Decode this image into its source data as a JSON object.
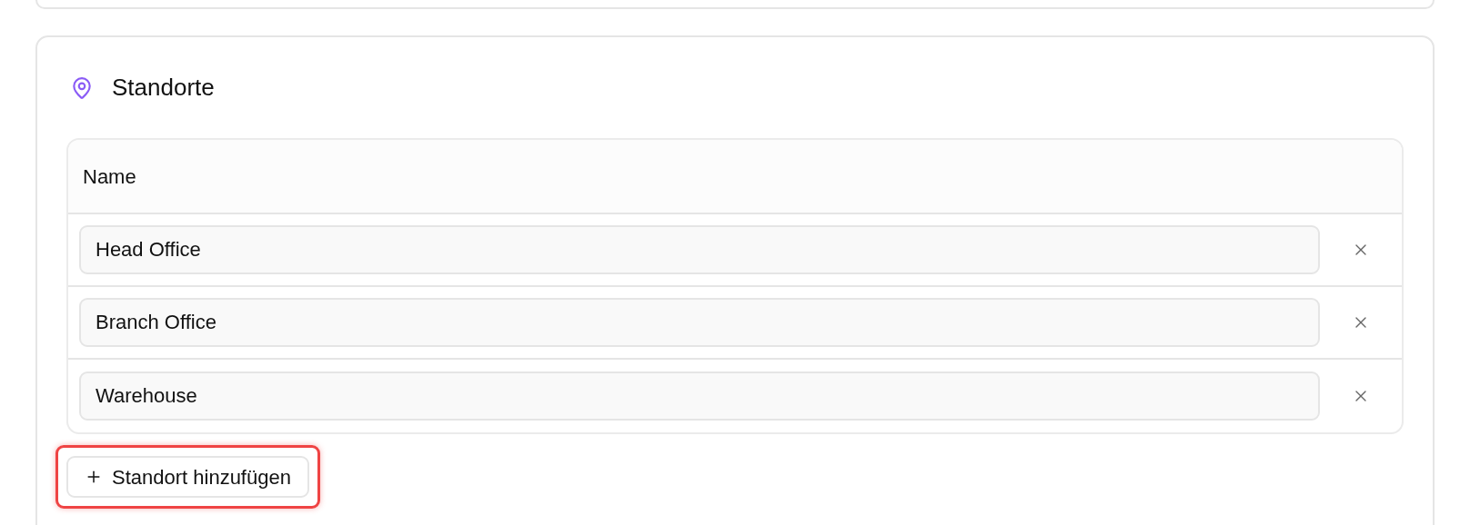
{
  "section": {
    "title": "Standorte"
  },
  "table": {
    "columns": [
      "Name"
    ],
    "rows": [
      {
        "name": "Head Office"
      },
      {
        "name": "Branch Office"
      },
      {
        "name": "Warehouse"
      }
    ]
  },
  "add_button": {
    "label": "Standort hinzufügen",
    "highlighted": true
  }
}
